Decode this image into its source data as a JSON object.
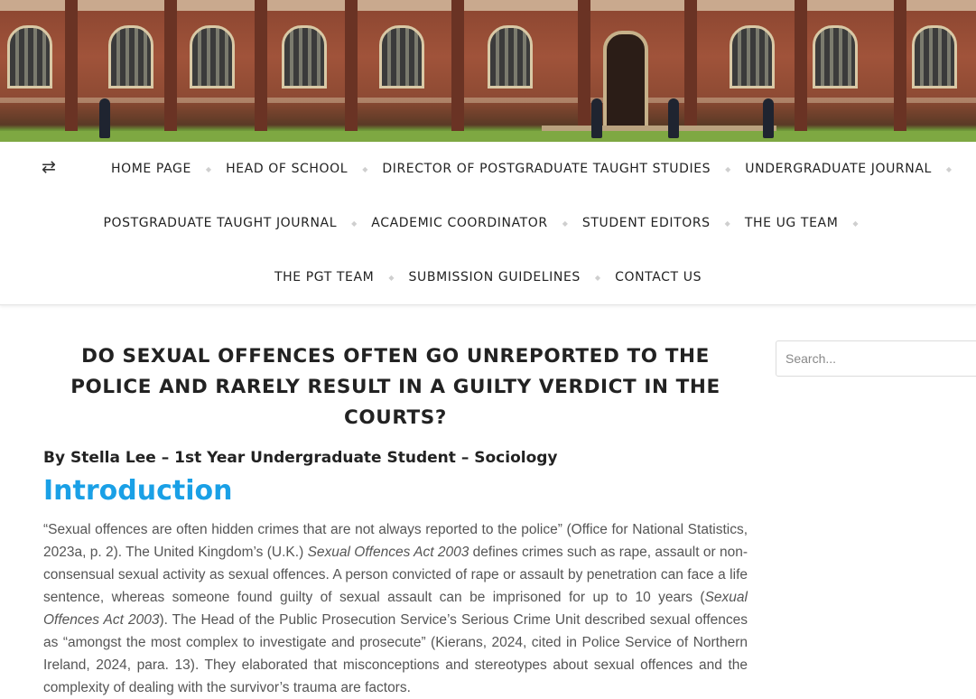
{
  "nav": {
    "row1": [
      "HOME PAGE",
      "HEAD OF SCHOOL",
      "DIRECTOR OF POSTGRADUATE TAUGHT STUDIES",
      "UNDERGRADUATE JOURNAL"
    ],
    "row2": [
      "POSTGRADUATE TAUGHT JOURNAL",
      "ACADEMIC COORDINATOR",
      "STUDENT EDITORS",
      "THE UG TEAM"
    ],
    "row3": [
      "THE PGT TEAM",
      "SUBMISSION GUIDELINES",
      "CONTACT US"
    ],
    "icon": "retweet-icon"
  },
  "post": {
    "title": "DO SEXUAL OFFENCES OFTEN GO UNREPORTED TO THE POLICE AND RARELY RESULT IN A GUILTY VERDICT IN THE COURTS?",
    "byline": "By Stella Lee – 1st Year Undergraduate Student – Sociology",
    "section_heading": "Introduction",
    "paragraph": {
      "p1": "“Sexual offences are often hidden crimes that are not always reported to the police” (Office for National Statistics, 2023a, p. 2). The United Kingdom’s (U.K.) ",
      "i1": "Sexual Offences Act 2003",
      "p2": " defines crimes such as rape, assault or non-consensual sexual activity as sexual offences. A person convicted of rape or assault by penetration can face a life sentence, whereas someone found guilty of sexual assault can be imprisoned for up to 10 years (",
      "i2": "Sexual Offences Act 2003",
      "p3": "). The Head of the Public Prosecution Service’s Serious Crime Unit described sexual offences as “amongst the most complex to investigate and prosecute” (Kierans, 2024, cited in Police Service of Northern Ireland, 2024, para. 13). They elaborated that misconceptions and stereotypes about sexual offences and the complexity of dealing with the survivor’s trauma are factors."
    }
  },
  "sidebar": {
    "search_placeholder": "Search..."
  },
  "colors": {
    "accent": "#1aa0e6",
    "heading": "#222222",
    "body_text": "#555555"
  }
}
